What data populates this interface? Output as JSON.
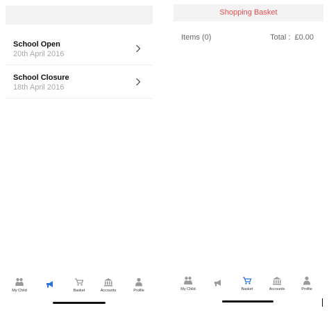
{
  "colors": {
    "accent": "#2a73d9",
    "basket_title": "#e44d4d",
    "inactive_icon": "#9a9a9a",
    "date_text": "#a8a8a8"
  },
  "notifications": {
    "items": [
      {
        "title": "School Open",
        "date": "20th April 2016",
        "icon": "chevron-right-icon"
      },
      {
        "title": "School Closure",
        "date": "18th April 2016",
        "icon": "chevron-right-icon"
      }
    ]
  },
  "basket": {
    "title": "Shopping Basket",
    "items_label": "Items (0)",
    "total_label": "Total :",
    "total_value": "£0.00"
  },
  "tabbar_left": {
    "active": "notices",
    "tabs": [
      {
        "id": "my-child",
        "label": "My Child",
        "icon": "children-icon"
      },
      {
        "id": "notices",
        "label": "",
        "icon": "megaphone-icon"
      },
      {
        "id": "basket",
        "label": "Basket",
        "icon": "cart-icon"
      },
      {
        "id": "accounts",
        "label": "Accounts",
        "icon": "bank-icon"
      },
      {
        "id": "profile",
        "label": "Profile",
        "icon": "person-icon"
      }
    ]
  },
  "tabbar_right": {
    "active": "basket",
    "tabs": [
      {
        "id": "my-child",
        "label": "My Child",
        "icon": "children-icon"
      },
      {
        "id": "notices",
        "label": "",
        "icon": "megaphone-icon"
      },
      {
        "id": "basket",
        "label": "Basket",
        "icon": "cart-icon"
      },
      {
        "id": "accounts",
        "label": "Accounts",
        "icon": "bank-icon"
      },
      {
        "id": "profile",
        "label": "Profile",
        "icon": "person-icon"
      }
    ]
  }
}
